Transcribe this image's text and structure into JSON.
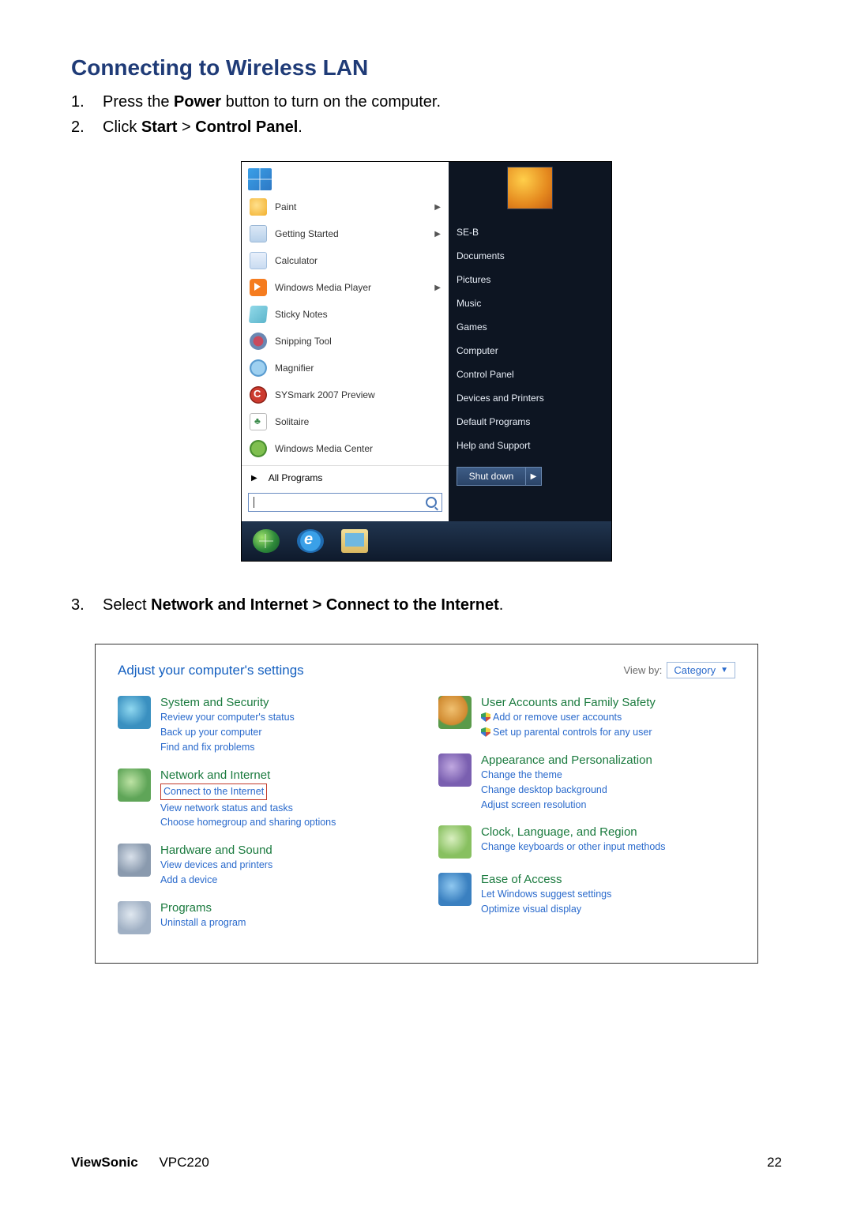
{
  "heading": "Connecting to Wireless LAN",
  "steps": [
    {
      "num": "1.",
      "pre": "Press the ",
      "b1": "Power",
      "post": " button to turn on the computer."
    },
    {
      "num": "2.",
      "pre": "Click ",
      "b1": "Start",
      "mid": " > ",
      "b2": "Control Panel",
      "post": "."
    },
    {
      "num": "3.",
      "pre": "Select ",
      "b1": "Network and Internet > Connect to the Internet",
      "post": "."
    }
  ],
  "startmenu": {
    "items": [
      {
        "label": "Paint",
        "arrow": true
      },
      {
        "label": "Getting Started",
        "arrow": true
      },
      {
        "label": "Calculator"
      },
      {
        "label": "Windows Media Player",
        "arrow": true
      },
      {
        "label": "Sticky Notes"
      },
      {
        "label": "Snipping Tool"
      },
      {
        "label": "Magnifier"
      },
      {
        "label": "SYSmark 2007 Preview"
      },
      {
        "label": "Solitaire"
      },
      {
        "label": "Windows Media Center"
      }
    ],
    "allPrograms": "All Programs",
    "right": [
      "SE-B",
      "Documents",
      "Pictures",
      "Music",
      "Games",
      "Computer",
      "Control Panel",
      "Devices and Printers",
      "Default Programs",
      "Help and Support"
    ],
    "shutdown": "Shut down"
  },
  "controlPanel": {
    "title": "Adjust your computer's settings",
    "viewByLabel": "View by:",
    "viewByValue": "Category",
    "left": [
      {
        "title": "System and Security",
        "links": [
          "Review your computer's status",
          "Back up your computer",
          "Find and fix problems"
        ]
      },
      {
        "title": "Network and Internet",
        "links": [
          "Connect to the Internet",
          "View network status and tasks",
          "Choose homegroup and sharing options"
        ],
        "boxedIndex": 0
      },
      {
        "title": "Hardware and Sound",
        "links": [
          "View devices and printers",
          "Add a device"
        ]
      },
      {
        "title": "Programs",
        "links": [
          "Uninstall a program"
        ]
      }
    ],
    "right": [
      {
        "title": "User Accounts and Family Safety",
        "links": [
          "Add or remove user accounts",
          "Set up parental controls for any user"
        ],
        "shield": true
      },
      {
        "title": "Appearance and Personalization",
        "links": [
          "Change the theme",
          "Change desktop background",
          "Adjust screen resolution"
        ]
      },
      {
        "title": "Clock, Language, and Region",
        "links": [
          "Change keyboards or other input methods"
        ]
      },
      {
        "title": "Ease of Access",
        "links": [
          "Let Windows suggest settings",
          "Optimize visual display"
        ]
      }
    ]
  },
  "footer": {
    "brand": "ViewSonic",
    "model": "VPC220",
    "page": "22"
  }
}
